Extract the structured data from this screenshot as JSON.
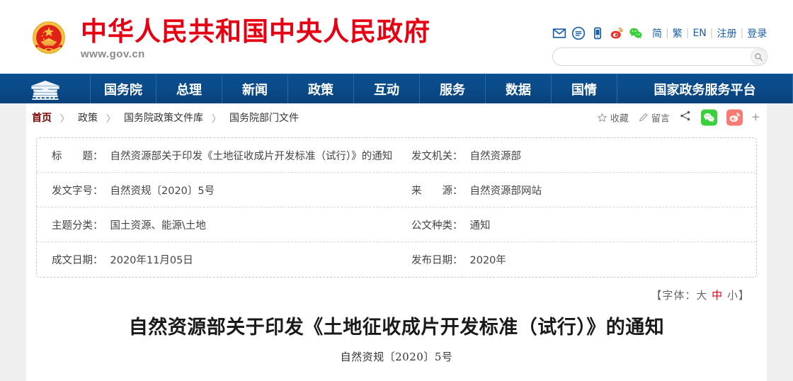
{
  "site": {
    "title": "中华人民共和国中央人民政府",
    "url_main": "www",
    "url_dot1": ".",
    "url_gov": "gov",
    "url_dot2": ".",
    "url_cn": "cn",
    "url_full": "www.gov.cn",
    "emblem_alt": "national-emblem"
  },
  "utility": {
    "icons": [
      {
        "name": "mail-icon",
        "label": "邮箱"
      },
      {
        "name": "message-icon",
        "label": "留言"
      },
      {
        "name": "mobile-icon",
        "label": "手机版"
      },
      {
        "name": "weibo-icon",
        "label": "微博"
      },
      {
        "name": "wechat-icon",
        "label": "微信"
      }
    ],
    "links": [
      "简",
      "繁",
      "EN",
      "注册",
      "登录"
    ],
    "separator": "|"
  },
  "search": {
    "value": "",
    "placeholder": "",
    "button_name": "search-button"
  },
  "nav": {
    "home_icon": "tiananmen-icon",
    "items": [
      {
        "label": "国务院",
        "width": "plain"
      },
      {
        "label": "总理",
        "width": "plain"
      },
      {
        "label": "新闻",
        "width": "plain"
      },
      {
        "label": "政策",
        "width": "plain"
      },
      {
        "label": "互动",
        "width": "plain"
      },
      {
        "label": "服务",
        "width": "plain"
      },
      {
        "label": "数据",
        "width": "plain"
      },
      {
        "label": "国情",
        "width": "plain"
      },
      {
        "label": "国家政务服务平台",
        "width": "wide"
      }
    ]
  },
  "breadcrumb": {
    "arrow": "〉",
    "items": [
      "首页",
      "政策",
      "国务院政策文件库",
      "国务院部门文件"
    ]
  },
  "actions": {
    "favorite": {
      "label": "收藏",
      "icon": "star-icon"
    },
    "comment": {
      "label": "留言",
      "icon": "pencil-icon"
    },
    "share": {
      "icon": "share-icon"
    },
    "wechat": {
      "icon": "wechat-icon"
    },
    "weibo": {
      "icon": "weibo-icon"
    },
    "more": {
      "label": "+",
      "icon": "plus-icon"
    }
  },
  "meta": {
    "rows": [
      {
        "left": {
          "label": "标　　题：",
          "value": "自然资源部关于印发《土地征收成片开发标准（试行）》的通知"
        },
        "right": {
          "label": "发文机关：",
          "value": "自然资源部"
        }
      },
      {
        "left": {
          "label": "发文字号：",
          "value": "自然资规〔2020〕5号"
        },
        "right": {
          "label": "来　　源：",
          "value": "自然资源部网站"
        }
      },
      {
        "left": {
          "label": "主题分类：",
          "value": "国土资源、能源\\土地"
        },
        "right": {
          "label": "公文种类：",
          "value": "通知"
        }
      },
      {
        "left": {
          "label": "成文日期：",
          "value": "2020年11月05日"
        },
        "right": {
          "label": "发布日期：",
          "value": "2020年"
        }
      }
    ]
  },
  "fontsize": {
    "prefix": "【字体：",
    "large": "大",
    "medium": "中",
    "small": "小",
    "suffix": "】",
    "active": "中"
  },
  "article": {
    "title": "自然资源部关于印发《土地征收成片开发标准（试行）》的通知",
    "subtitle": "自然资规〔2020〕5号"
  },
  "colors": {
    "brand_red": "#e50113",
    "nav_blue": "#0b4f91",
    "link_blue": "#1a5fa8",
    "crumb_home": "#7b0000",
    "wechat_green": "#3ccf3c",
    "weibo_red": "#f77b72",
    "page_bg": "#efefef",
    "accent_active": "#e50113"
  }
}
